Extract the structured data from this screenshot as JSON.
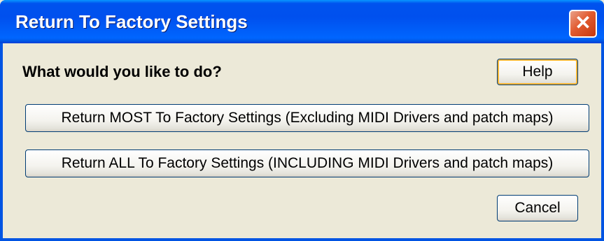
{
  "window": {
    "title": "Return To Factory Settings",
    "close_glyph": "✕"
  },
  "dialog": {
    "question": "What would you like to do?",
    "help_label": "Help",
    "return_most_label": "Return MOST To Factory Settings  (Excluding MIDI Drivers and patch maps)",
    "return_all_label": "Return ALL To Factory Settings  (INCLUDING MIDI Drivers and patch maps)",
    "cancel_label": "Cancel"
  },
  "colors": {
    "titlebar": "#0054e3",
    "close_button": "#e25b30",
    "dialog_background": "#ece9d8",
    "button_border": "#003c74"
  }
}
